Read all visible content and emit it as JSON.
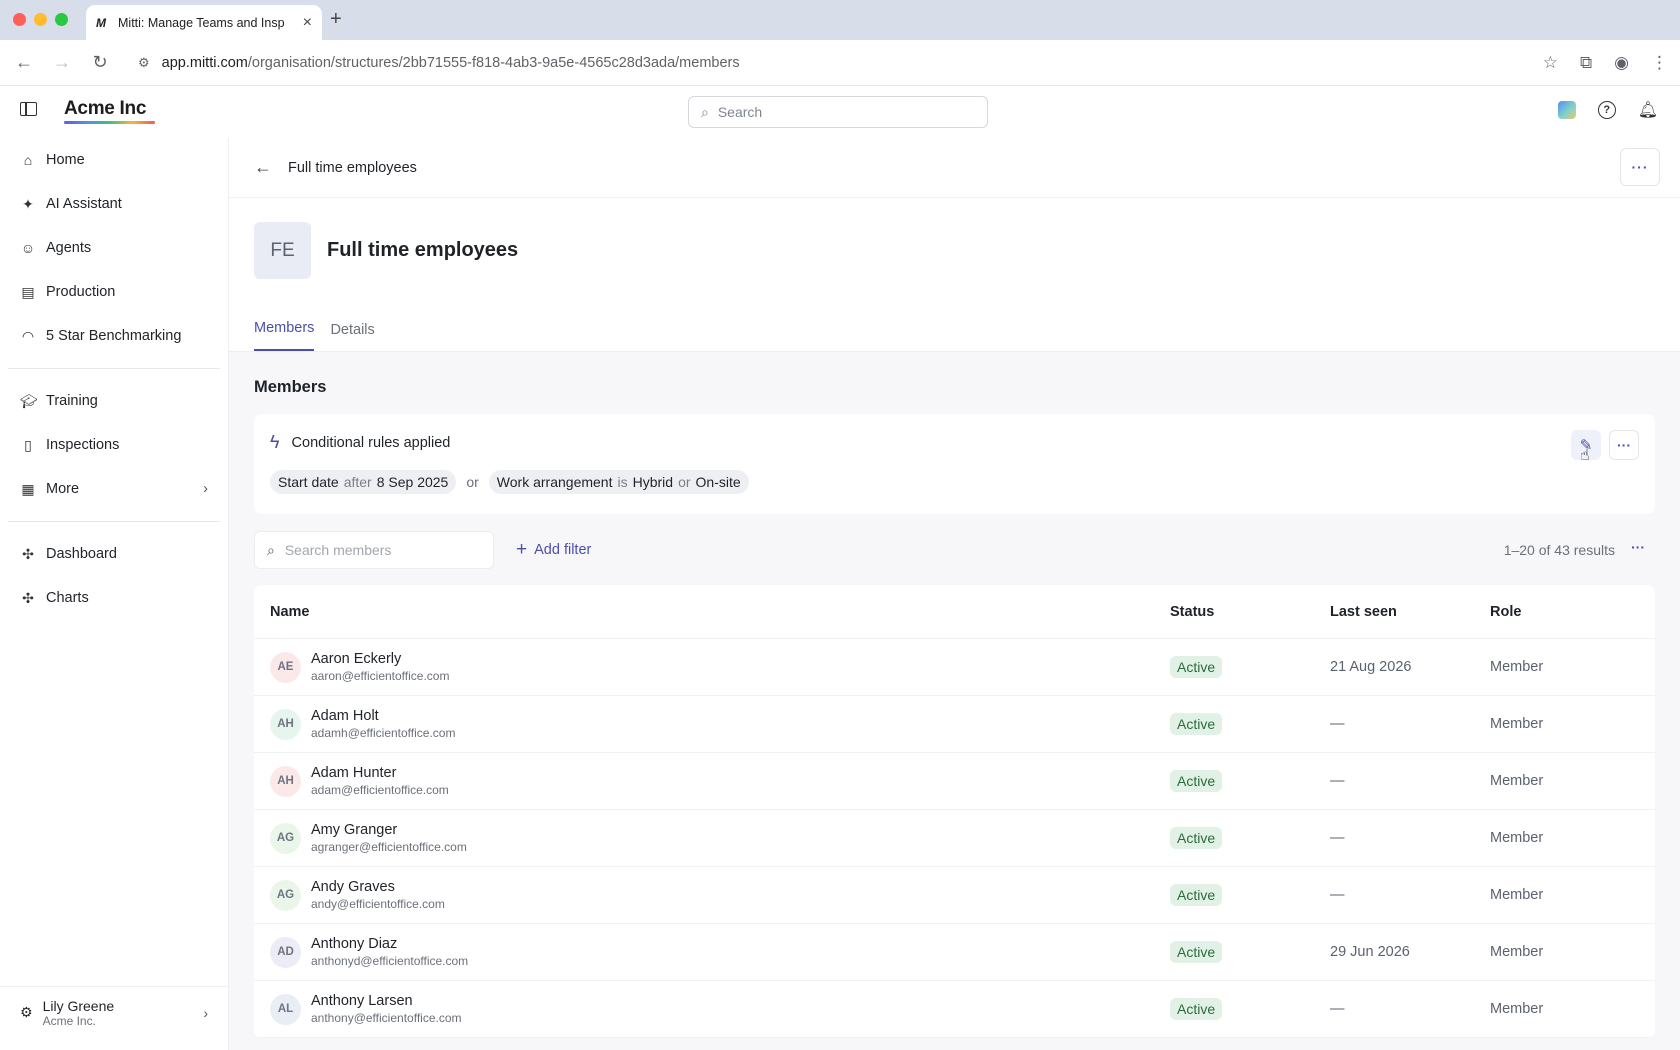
{
  "browser": {
    "tab_title": "Mitti: Manage Teams and Insp",
    "tab_favicon": "M",
    "url_host": "app.mitti.com",
    "url_path": "/organisation/structures/2bb71555-f818-4ab3-9a5e-4565c28d3ada/members"
  },
  "header": {
    "brand": "Acme Inc",
    "search_placeholder": "Search"
  },
  "sidebar": {
    "items": [
      {
        "label": "Home",
        "icon": "home-icon"
      },
      {
        "label": "AI Assistant",
        "icon": "sparkle-icon"
      },
      {
        "label": "Agents",
        "icon": "robot-icon"
      },
      {
        "label": "Production",
        "icon": "building-icon"
      },
      {
        "label": "5 Star Benchmarking",
        "icon": "gauge-icon"
      },
      {
        "label": "Training",
        "icon": "graduation-cap-icon"
      },
      {
        "label": "Inspections",
        "icon": "clipboard-icon"
      },
      {
        "label": "More",
        "icon": "grid-icon"
      },
      {
        "label": "Dashboard",
        "icon": "puzzle-icon"
      },
      {
        "label": "Charts",
        "icon": "puzzle-icon"
      }
    ],
    "user": {
      "name": "Lily Greene",
      "org": "Acme Inc."
    }
  },
  "page": {
    "breadcrumb": "Full time employees",
    "avatar_initials": "FE",
    "title": "Full time employees",
    "tabs": [
      "Members",
      "Details"
    ],
    "active_tab": "Members",
    "section_title": "Members",
    "rules": {
      "title": "Conditional rules applied",
      "chip1": {
        "field": "Start date",
        "op": "after",
        "value": "8 Sep 2025"
      },
      "joiner": "or",
      "chip2": {
        "field": "Work arrangement",
        "op": "is",
        "value1": "Hybrid",
        "op2": "or",
        "value2": "On-site"
      }
    },
    "members_search_placeholder": "Search members",
    "add_filter": "Add filter",
    "results": "1–20 of 43 results"
  },
  "table": {
    "columns": [
      "Name",
      "Status",
      "Last seen",
      "Role"
    ],
    "rows": [
      {
        "initials": "AE",
        "name": "Aaron Eckerly",
        "email": "aaron@efficientoffice.com",
        "status": "Active",
        "last_seen": "21 Aug 2026",
        "role": "Member",
        "avatar_color": "#fbe9ea"
      },
      {
        "initials": "AH",
        "name": "Adam Holt",
        "email": "adamh@efficientoffice.com",
        "status": "Active",
        "last_seen": "—",
        "role": "Member",
        "avatar_color": "#e6f5ee"
      },
      {
        "initials": "AH",
        "name": "Adam Hunter",
        "email": "adam@efficientoffice.com",
        "status": "Active",
        "last_seen": "—",
        "role": "Member",
        "avatar_color": "#fbe9ea"
      },
      {
        "initials": "AG",
        "name": "Amy Granger",
        "email": "agranger@efficientoffice.com",
        "status": "Active",
        "last_seen": "—",
        "role": "Member",
        "avatar_color": "#eaf6e9"
      },
      {
        "initials": "AG",
        "name": "Andy Graves",
        "email": "andy@efficientoffice.com",
        "status": "Active",
        "last_seen": "—",
        "role": "Member",
        "avatar_color": "#eaf6e9"
      },
      {
        "initials": "AD",
        "name": "Anthony Diaz",
        "email": "anthonyd@efficientoffice.com",
        "status": "Active",
        "last_seen": "29 Jun 2026",
        "role": "Member",
        "avatar_color": "#ececf6"
      },
      {
        "initials": "AL",
        "name": "Anthony Larsen",
        "email": "anthony@efficientoffice.com",
        "status": "Active",
        "last_seen": "—",
        "role": "Member",
        "avatar_color": "#e8edf6"
      }
    ]
  },
  "colors": {
    "accent": "#4b4fa8",
    "active_badge": "#e2f1e6"
  }
}
